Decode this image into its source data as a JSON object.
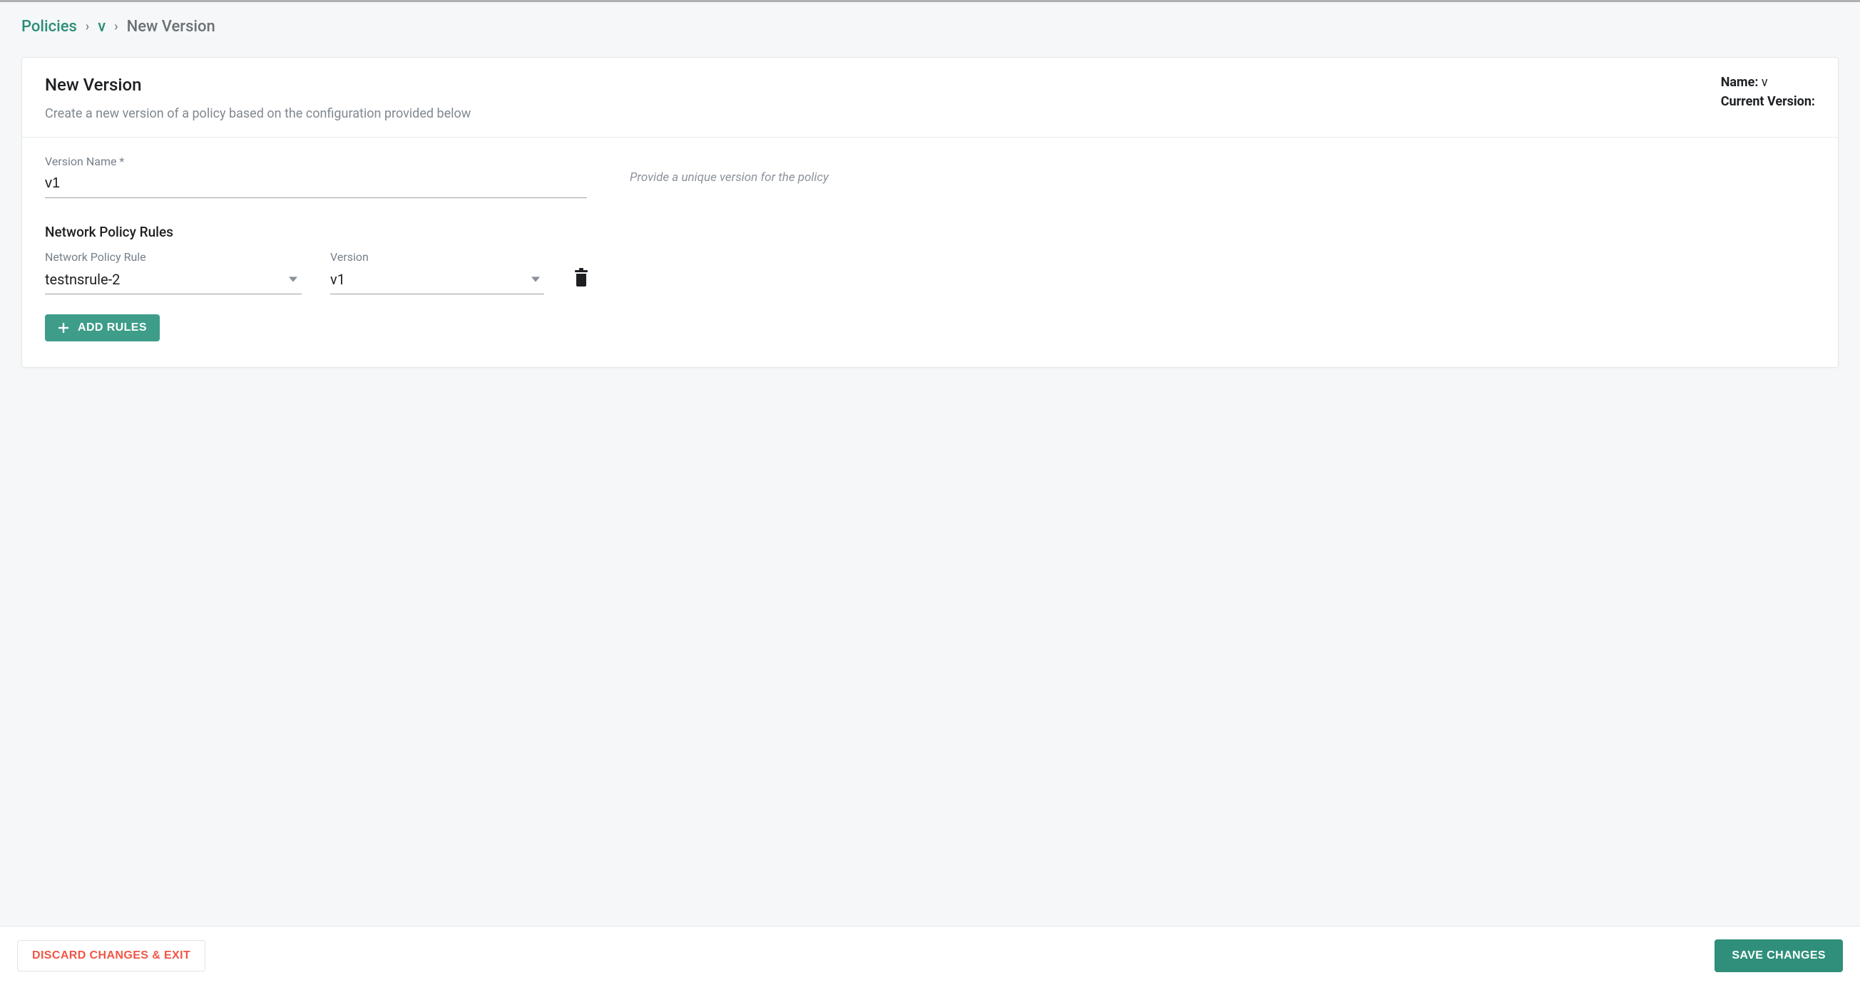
{
  "breadcrumb": {
    "items": [
      {
        "label": "Policies",
        "link": true
      },
      {
        "label": "v",
        "link": true
      },
      {
        "label": "New Version",
        "link": false
      }
    ]
  },
  "header": {
    "title": "New Version",
    "subtitle": "Create a new version of a policy based on the configuration provided below",
    "name_label": "Name:",
    "name_value": "v",
    "current_version_label": "Current Version:",
    "current_version_value": ""
  },
  "form": {
    "version_name": {
      "label": "Version Name *",
      "value": "v1",
      "hint": "Provide a unique version for the policy"
    },
    "rules_section_title": "Network Policy Rules",
    "rule_label": "Network Policy Rule",
    "version_label": "Version",
    "rules": [
      {
        "rule": "testnsrule-2",
        "version": "v1"
      }
    ],
    "add_rules_label": "ADD RULES"
  },
  "footer": {
    "discard_label": "DISCARD CHANGES & EXIT",
    "save_label": "SAVE CHANGES"
  },
  "icons": {
    "chevron_down": "chevron-down-icon",
    "trash": "trash-icon",
    "plus": "plus-icon"
  }
}
